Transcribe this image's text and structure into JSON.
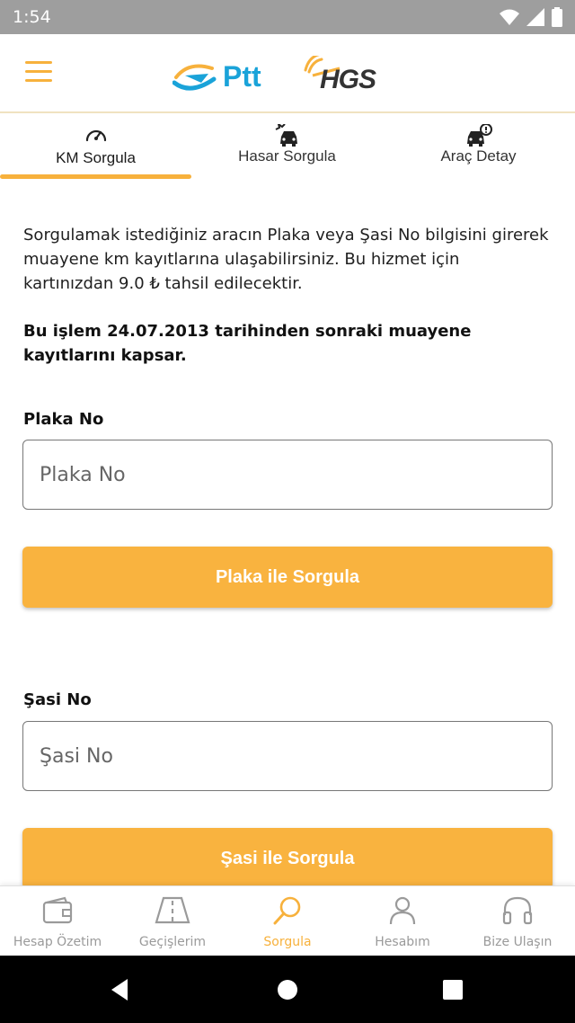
{
  "status_bar": {
    "time": "1:54"
  },
  "header": {
    "menu_icon": "hamburger-icon",
    "ptt_logo_text": "Ptt",
    "hgs_logo_text": "HGS"
  },
  "tabs": [
    {
      "label": "KM Sorgula",
      "icon": "speedometer-icon",
      "active": true
    },
    {
      "label": "Hasar Sorgula",
      "icon": "car-crash-icon",
      "active": false
    },
    {
      "label": "Araç Detay",
      "icon": "car-alert-icon",
      "active": false
    }
  ],
  "main": {
    "description": "Sorgulamak istediğiniz aracın Plaka veya Şasi No bilgisini girerek muayene km kayıtlarına ulaşabilirsiniz. Bu hizmet için kartınızdan 9.0 ₺ tahsil edilecektir.",
    "note": "Bu işlem 24.07.2013 tarihinden sonraki muayene kayıtlarını kapsar.",
    "plate": {
      "label": "Plaka No",
      "placeholder": "Plaka No",
      "button": "Plaka ile Sorgula"
    },
    "chassis": {
      "label": "Şasi No",
      "placeholder": "Şasi No",
      "button": "Şasi ile Sorgula"
    }
  },
  "bottom_nav": [
    {
      "label": "Hesap Özetim",
      "icon": "wallet-icon",
      "active": false
    },
    {
      "label": "Geçişlerim",
      "icon": "road-icon",
      "active": false
    },
    {
      "label": "Sorgula",
      "icon": "search-icon",
      "active": true
    },
    {
      "label": "Hesabım",
      "icon": "user-icon",
      "active": false
    },
    {
      "label": "Bize Ulaşın",
      "icon": "headphones-icon",
      "active": false
    }
  ],
  "colors": {
    "accent": "#f7b13c",
    "button": "#f9b33f",
    "ptt_blue": "#1aa3d9",
    "status_bar": "#9e9e9e",
    "inactive_nav": "#9a9a9a"
  }
}
